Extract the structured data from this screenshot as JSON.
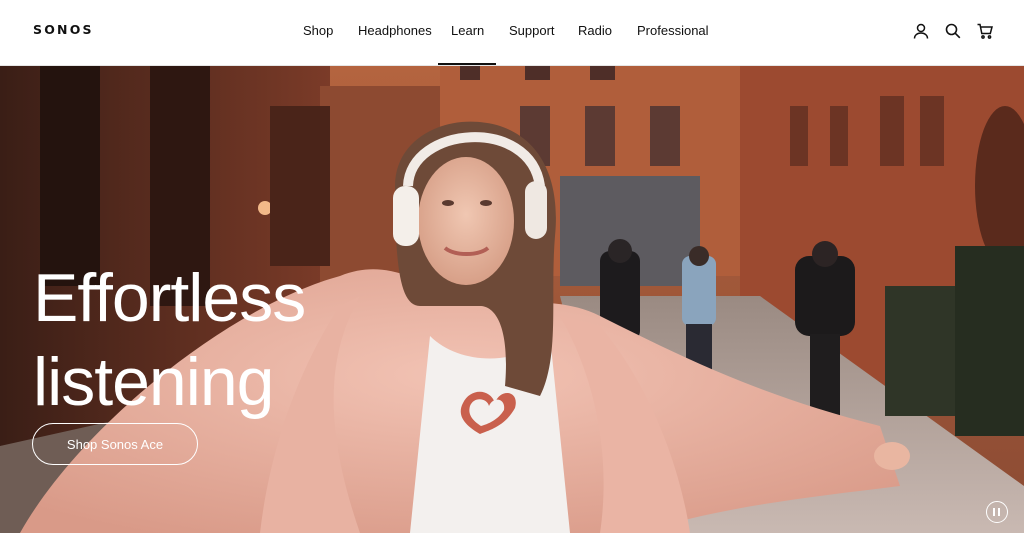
{
  "brand": {
    "logo_text": "SONOS"
  },
  "nav": {
    "items": [
      {
        "label": "Shop"
      },
      {
        "label": "Headphones"
      },
      {
        "label": "Learn"
      },
      {
        "label": "Support"
      },
      {
        "label": "Radio"
      },
      {
        "label": "Professional"
      }
    ],
    "active_item": "Learn"
  },
  "tools": {
    "account_icon": "account-icon",
    "search_icon": "search-icon",
    "cart_icon": "cart-icon"
  },
  "hero": {
    "headline_line1": "Effortless",
    "headline_line2": "listening",
    "cta_label": "Shop Sonos Ace",
    "pause_icon": "pause-icon"
  },
  "colors": {
    "brand_text": "#111111",
    "hero_text": "#ffffff"
  }
}
